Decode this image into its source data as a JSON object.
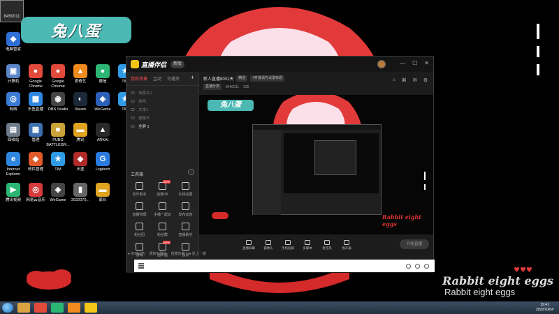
{
  "desktop": {
    "corner_label": "8450011",
    "banner": "兔八蛋",
    "rabbit_title": "Rabbit eight eggs",
    "rabbit_subtitle": "Rabbit eight eggs",
    "icons": [
      {
        "label": "电脑管家",
        "color": "#2f6fd6",
        "glyph": "◆"
      },
      {
        "label": "计算机",
        "color": "#5a86c7",
        "glyph": "▣"
      },
      {
        "label": "Google Chrome",
        "color": "#e24a3a",
        "glyph": "●"
      },
      {
        "label": "Google Chrome",
        "color": "#e24a3a",
        "glyph": "●"
      },
      {
        "label": "爱奇艺",
        "color": "#f08a1c",
        "glyph": "▲"
      },
      {
        "label": "微信",
        "color": "#2bb673",
        "glyph": "●"
      },
      {
        "label": "TIM",
        "color": "#2f9be6",
        "glyph": "★"
      },
      {
        "label": "网络",
        "color": "#3a7bd5",
        "glyph": "◎"
      },
      {
        "label": "乐鱼直播",
        "color": "#2f86e0",
        "glyph": "▦"
      },
      {
        "label": "OBS Studio",
        "color": "#444444",
        "glyph": "◉"
      },
      {
        "label": "Steam",
        "color": "#1b2838",
        "glyph": "◐"
      },
      {
        "label": "WeGame",
        "color": "#2b5fb8",
        "glyph": "◈"
      },
      {
        "label": "TIM",
        "color": "#2f9be6",
        "glyph": "★"
      },
      {
        "label": "回收站",
        "color": "#6c7a89",
        "glyph": "▤"
      },
      {
        "label": "管理",
        "color": "#3d6fb0",
        "glyph": "▦"
      },
      {
        "label": "PUBG BATTLEGR...",
        "color": "#c9a23a",
        "glyph": "■"
      },
      {
        "label": "腾讯",
        "color": "#e0a420",
        "glyph": "▬"
      },
      {
        "label": "ARKAI",
        "color": "#2a2a2a",
        "glyph": "▲"
      },
      {
        "label": "Internet Explorer",
        "color": "#2f86e0",
        "glyph": "e"
      },
      {
        "label": "软件管理",
        "color": "#e05a2a",
        "glyph": "◆"
      },
      {
        "label": "TIM",
        "color": "#2f9be6",
        "glyph": "★"
      },
      {
        "label": "天涯",
        "color": "#b02a2a",
        "glyph": "◆"
      },
      {
        "label": "Logitech",
        "color": "#2a7be0",
        "glyph": "G"
      },
      {
        "label": "腾讯视频",
        "color": "#2bb673",
        "glyph": "▶"
      },
      {
        "label": "网易云音乐",
        "color": "#d63a3a",
        "glyph": "◎"
      },
      {
        "label": "WeGame",
        "color": "#444444",
        "glyph": "◈"
      },
      {
        "label": "2022070...",
        "color": "#666666",
        "glyph": "▮"
      },
      {
        "label": "家长",
        "color": "#e0a420",
        "glyph": "▬"
      }
    ]
  },
  "app": {
    "name": "直播伴侣",
    "version": "新版",
    "window_controls": [
      "—",
      "☐",
      "✕"
    ],
    "left_tabs": {
      "active": "我的场景",
      "tab2": "互动",
      "tab3": "可通关",
      "add": "+"
    },
    "scenes": [
      {
        "label": "场景名1",
        "selected": false
      },
      {
        "label": "游戏",
        "selected": false
      },
      {
        "label": "文本1",
        "selected": false
      },
      {
        "label": "摄像头",
        "selected": false
      },
      {
        "label": "全屏 1",
        "selected": true
      }
    ],
    "toolbox_title": "工具箱",
    "toolbox_more": "›",
    "tools": [
      {
        "label": "音乐助手",
        "badge": ""
      },
      {
        "label": "连麦PK",
        "badge": "NEW"
      },
      {
        "label": "礼物设置",
        "badge": ""
      },
      {
        "label": "直播管理",
        "badge": ""
      },
      {
        "label": "主播一起玩",
        "badge": ""
      },
      {
        "label": "发布动态",
        "badge": ""
      },
      {
        "label": "粉丝团",
        "badge": ""
      },
      {
        "label": "粉丝群",
        "badge": ""
      },
      {
        "label": "直播助手",
        "badge": ""
      },
      {
        "label": "游戏",
        "badge": ""
      },
      {
        "label": "画中画",
        "badge": "NEW"
      },
      {
        "label": "投屏",
        "badge": ""
      }
    ],
    "room": {
      "title": "新人直播8001天",
      "tag1": "精选",
      "tag2": "#开播请先设置标题",
      "sub1": "直播分类",
      "sub2": "8450011",
      "sub3": "335"
    },
    "preview": {
      "mini_banner": "兔八蛋",
      "rabbit_label": "Rabbit eight eggs"
    },
    "bottom_buttons": [
      "直播屏幕",
      "摄像头",
      "手机投屏",
      "多媒体",
      "麦克风",
      "扬声器"
    ],
    "start_button": "开始直播",
    "status": [
      "● 实时公告",
      "通知可显示",
      "直播信息",
      "● 星上一期"
    ]
  },
  "taskbar": {
    "time": "19:41",
    "date": "2022/10/04"
  }
}
